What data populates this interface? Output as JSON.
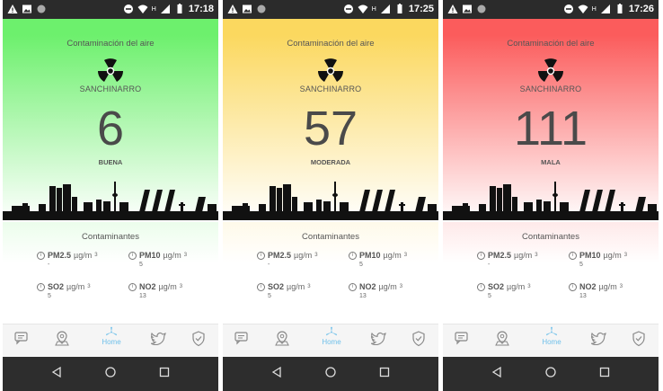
{
  "screens": [
    {
      "time": "17:18",
      "title": "Contaminación del aire",
      "district": "SANCHINARRO",
      "aqi": "6",
      "level": "BUENA",
      "colors": {
        "top": "#6df06d",
        "bottom": "#ffffff"
      },
      "pollutants_title": "Contaminantes",
      "pollutants": [
        {
          "name": "PM2.5",
          "unit": "µg/m",
          "exp": "3",
          "value": "-"
        },
        {
          "name": "PM10",
          "unit": "µg/m",
          "exp": "3",
          "value": "5"
        },
        {
          "name": "SO2",
          "unit": "µg/m",
          "exp": "3",
          "value": "5"
        },
        {
          "name": "NO2",
          "unit": "µg/m",
          "exp": "3",
          "value": "13"
        }
      ],
      "nav_home": "Home"
    },
    {
      "time": "17:25",
      "title": "Contaminación del aire",
      "district": "SANCHINARRO",
      "aqi": "57",
      "level": "MODERADA",
      "colors": {
        "top": "#fbd85f",
        "bottom": "#ffffff"
      },
      "pollutants_title": "Contaminantes",
      "pollutants": [
        {
          "name": "PM2.5",
          "unit": "µg/m",
          "exp": "3",
          "value": "-"
        },
        {
          "name": "PM10",
          "unit": "µg/m",
          "exp": "3",
          "value": "5"
        },
        {
          "name": "SO2",
          "unit": "µg/m",
          "exp": "3",
          "value": "5"
        },
        {
          "name": "NO2",
          "unit": "µg/m",
          "exp": "3",
          "value": "13"
        }
      ],
      "nav_home": "Home"
    },
    {
      "time": "17:26",
      "title": "Contaminación del aire",
      "district": "SANCHINARRO",
      "aqi": "111",
      "level": "MALA",
      "colors": {
        "top": "#fb5c5c",
        "bottom": "#ffffff"
      },
      "pollutants_title": "Contaminantes",
      "pollutants": [
        {
          "name": "PM2.5",
          "unit": "µg/m",
          "exp": "3",
          "value": "-"
        },
        {
          "name": "PM10",
          "unit": "µg/m",
          "exp": "3",
          "value": "5"
        },
        {
          "name": "SO2",
          "unit": "µg/m",
          "exp": "3",
          "value": "5"
        },
        {
          "name": "NO2",
          "unit": "µg/m",
          "exp": "3",
          "value": "13"
        }
      ],
      "nav_home": "Home"
    }
  ],
  "icons": {
    "hero": "radiation-icon",
    "nav": [
      "chat-icon",
      "map-pin-icon",
      "home-pinwheel-icon",
      "twitter-icon",
      "shield-check-icon"
    ],
    "system": [
      "back-icon",
      "home-circle-icon",
      "recents-icon"
    ]
  },
  "accent": "#6fc0ea"
}
